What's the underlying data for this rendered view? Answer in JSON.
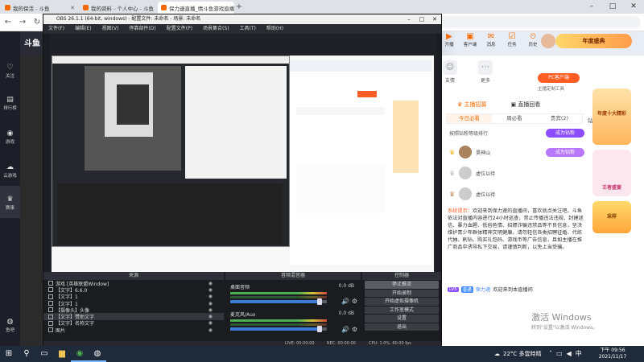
{
  "browser": {
    "tabs": [
      {
        "label": "我的保活 - 斗鱼",
        "active": false
      },
      {
        "label": "我的资料 - 个人中心 - 斗鱼",
        "active": false
      },
      {
        "label": "保力速直播_情斗鱼游戏直播_斗鱼直播",
        "active": true
      }
    ],
    "add_tab": "+",
    "win_min": "–",
    "win_max": "□",
    "win_close": "✕"
  },
  "site": {
    "logo": "斗鱼",
    "sidebar": [
      {
        "label": "关注",
        "icon": "♡"
      },
      {
        "label": "排行榜",
        "icon": "▤"
      },
      {
        "label": "游戏",
        "icon": "◉"
      },
      {
        "label": "云游戏",
        "icon": "☁"
      },
      {
        "label": "赛事",
        "icon": "♛"
      },
      {
        "label": "鱼吧",
        "icon": "◍"
      }
    ],
    "header_icons": [
      {
        "label": "开播",
        "icon": "▶"
      },
      {
        "label": "客户端",
        "icon": "▣"
      },
      {
        "label": "消息",
        "icon": "✉"
      },
      {
        "label": "任务",
        "icon": "☑"
      },
      {
        "label": "历史",
        "icon": "⏲"
      }
    ],
    "banner": "年度盛典"
  },
  "right_panel": {
    "icons": [
      {
        "label": "友情",
        "icon": "☺"
      },
      {
        "label": "更多",
        "icon": "⋯"
      }
    ],
    "pc_button": "PC客户端",
    "pc_sub": "主播定制工具",
    "tabs": [
      {
        "label": "主播招募",
        "selected": true
      },
      {
        "label": "直播回看",
        "selected": false
      }
    ],
    "subtabs": [
      {
        "label": "今日必看",
        "selected": true
      },
      {
        "label": "周必看",
        "selected": false
      },
      {
        "label": "贵宾(2)",
        "selected": false
      }
    ],
    "subtab_extra": "钻积(1)",
    "rank_title": "按照钻粉等级排行",
    "rank_button": "成为钻粉",
    "rank_items": [
      {
        "name": "昊神山"
      },
      {
        "name": "虚位以待"
      },
      {
        "name": "虚位以待"
      }
    ],
    "chat_system": {
      "tag": "系统提示：",
      "text": "欢迎来到保力速的直播间，喜欢就点关注吧。斗鱼依法对直播内容进行24小时巡查，禁止传播违法违规、封建迷信、暴力血腥、低俗色情、招嫖诈骗违禁品等不良信息，坚决维护青少年群体精神文明健康。请勿轻信各类招聘征婚、代练代抽、刷钻、购买礼包码、游戏币等广告信息，且如主播在推广商品中诱导私下交易，请谨慎判断，以免上当受骗。"
    },
    "chat_user": {
      "badge1": "LV5",
      "badge2": "普通",
      "name": "保力速",
      "text": "欢迎来到本直播间"
    },
    "deco_labels": [
      "年度十大精彩",
      "王者盛宴",
      "采样"
    ]
  },
  "obs": {
    "title": "OBS 26.1.1 (64-bit, windows) - 配置文件: 未命名 - 场景: 未命名",
    "menu": [
      "文件(F)",
      "编辑(E)",
      "视图(V)",
      "停靠部件(D)",
      "配置文件(P)",
      "场景集合(S)",
      "工具(T)",
      "帮助(H)"
    ],
    "docks": {
      "sources": "来源",
      "mixer": "音频混音器",
      "controls": "控制器"
    },
    "sources": [
      {
        "name": "游戏 [英雄联盟Window]",
        "selected": false
      },
      {
        "name": "【文字】6.6.0",
        "selected": false
      },
      {
        "name": "【文字】1",
        "selected": false
      },
      {
        "name": "【文字】1",
        "selected": false
      },
      {
        "name": "【摄像头】头像",
        "selected": false
      },
      {
        "name": "【文字】赞助文字",
        "selected": true
      },
      {
        "name": "【文字】名称文字",
        "selected": false
      },
      {
        "name": "图片",
        "selected": false
      }
    ],
    "mixer": [
      {
        "name": "桌面音频",
        "db": "0.0 dB"
      },
      {
        "name": "麦克风/Aux",
        "db": "0.0 dB"
      }
    ],
    "controls": [
      {
        "label": "停止推流",
        "active": true
      },
      {
        "label": "开始录制",
        "active": false
      },
      {
        "label": "开始虚拟摄像机",
        "active": false
      },
      {
        "label": "工作室模式",
        "active": false
      },
      {
        "label": "设置",
        "active": false
      },
      {
        "label": "退出",
        "active": false
      }
    ],
    "status": {
      "live": "LIVE: 00:00:00",
      "rec": "REC: 00:00:00",
      "cpu": "CPU: 1.0%, 60.00 fps"
    }
  },
  "activate": {
    "line1": "激活 Windows",
    "line2": "转到\"设置\"以激活 Windows。"
  },
  "taskbar": {
    "weather": "22°C 多雲時晴",
    "time": "下午 09:56",
    "date": "2021/11/17"
  }
}
